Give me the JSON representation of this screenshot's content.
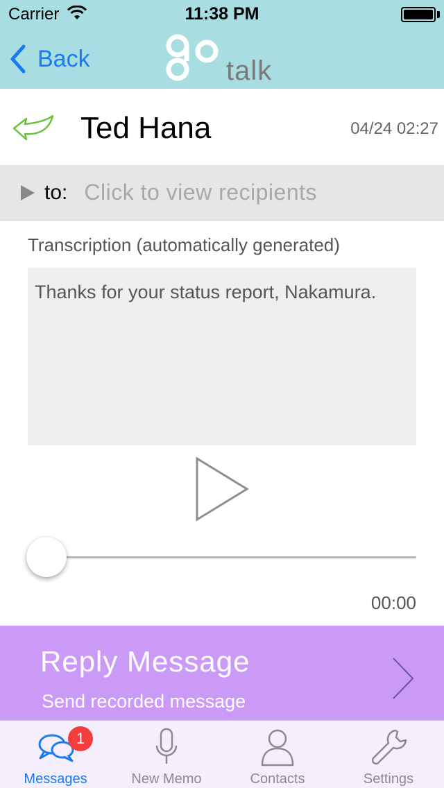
{
  "status_bar": {
    "carrier": "Carrier",
    "time": "11:38 PM"
  },
  "nav": {
    "back_label": "Back",
    "logo_text": "talk"
  },
  "message": {
    "sender": "Ted Hana",
    "date": "04/24 02:27",
    "to_label": "to:",
    "to_placeholder": "Click to view recipients"
  },
  "transcription": {
    "label": "Transcription (automatically generated)",
    "text": "Thanks for your status report, Nakamura."
  },
  "player": {
    "elapsed": "00:00",
    "position": 0
  },
  "reply": {
    "title": "Reply Message",
    "subtitle": "Send recorded message"
  },
  "tabs": [
    {
      "label": "Messages",
      "icon": "chat-bubbles-icon",
      "badge": "1",
      "active": true
    },
    {
      "label": "New Memo",
      "icon": "microphone-icon"
    },
    {
      "label": "Contacts",
      "icon": "person-icon"
    },
    {
      "label": "Settings",
      "icon": "wrench-icon"
    }
  ],
  "colors": {
    "header_bg": "#a8dde2",
    "accent_blue": "#1a7af0",
    "reply_banner": "#cb9af6",
    "reply_arrow": "#6fbf3e",
    "badge_red": "#f43d3d"
  }
}
